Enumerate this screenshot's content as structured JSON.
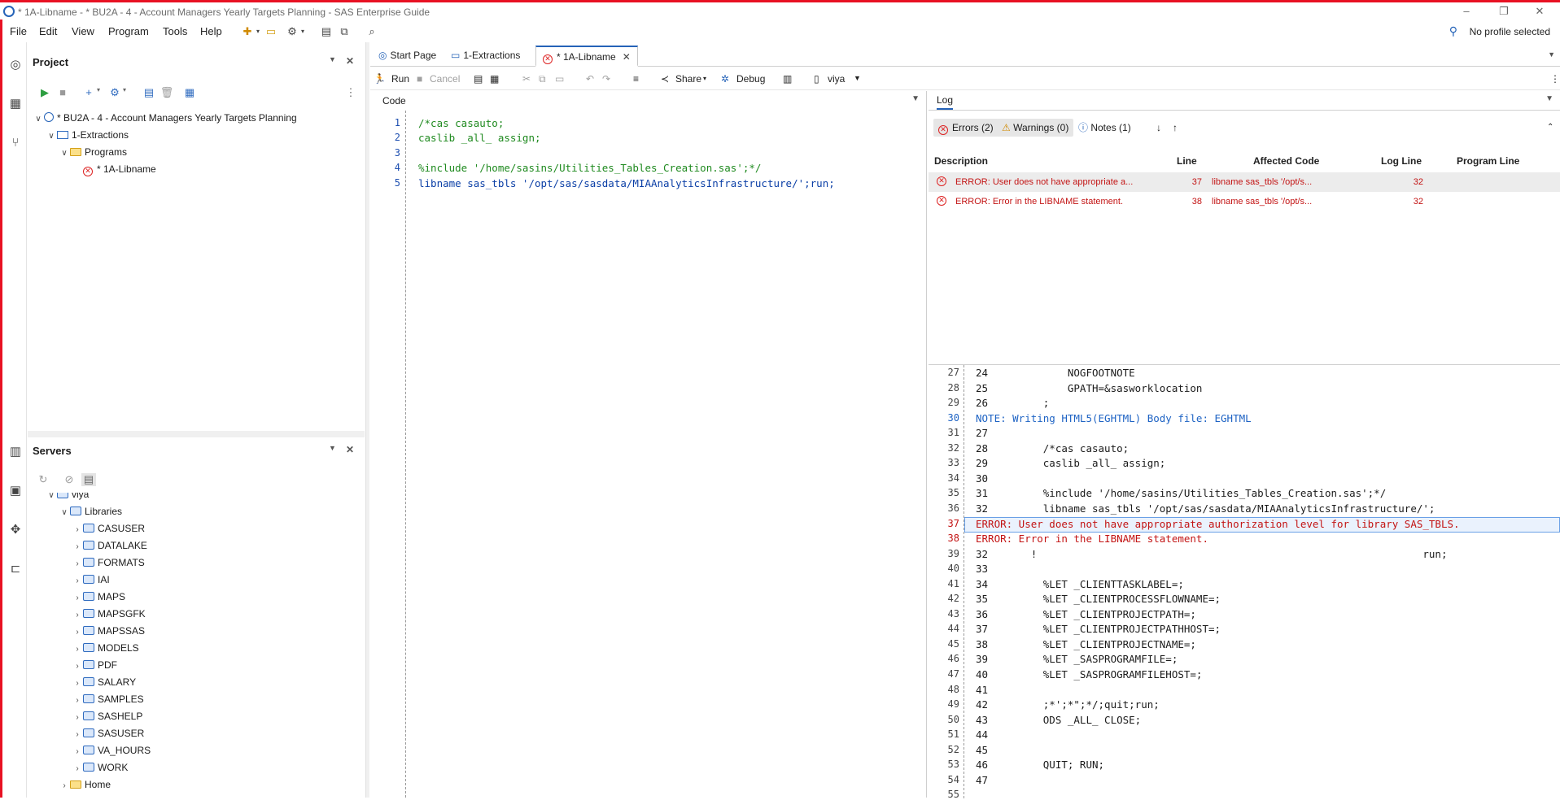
{
  "window": {
    "title": "* 1A-Libname - * BU2A - 4 - Account Managers Yearly Targets Planning - SAS Enterprise Guide"
  },
  "menu": {
    "items": [
      "File",
      "Edit",
      "View",
      "Program",
      "Tools",
      "Help"
    ],
    "profile_label": "No profile selected"
  },
  "project": {
    "title": "Project",
    "tree": [
      {
        "label": "* BU2A - 4 - Account Managers Yearly Targets Planning",
        "level": 0,
        "icon": "project-icon"
      },
      {
        "label": "1-Extractions",
        "level": 1,
        "icon": "process-flow-icon"
      },
      {
        "label": "Programs",
        "level": 2,
        "icon": "folder-icon"
      },
      {
        "label": "* 1A-Libname",
        "level": 3,
        "icon": "error-icon"
      }
    ]
  },
  "servers": {
    "title": "Servers",
    "partial_label": "viya",
    "libraries_label": "Libraries",
    "libraries": [
      "CASUSER",
      "DATALAKE",
      "FORMATS",
      "IAI",
      "MAPS",
      "MAPSGFK",
      "MAPSSAS",
      "MODELS",
      "PDF",
      "SALARY",
      "SAMPLES",
      "SASHELP",
      "SASUSER",
      "VA_HOURS",
      "WORK"
    ],
    "home_label": "Home"
  },
  "tabs": [
    {
      "label": "Start Page",
      "icon": "start-page-icon"
    },
    {
      "label": "1-Extractions",
      "icon": "process-flow-icon"
    },
    {
      "label": "* 1A-Libname",
      "icon": "error-icon",
      "active": true
    }
  ],
  "toolbar": {
    "run_label": "Run",
    "cancel_label": "Cancel",
    "share_label": "Share",
    "debug_label": "Debug",
    "server_label": "viya"
  },
  "code": {
    "header": "Code",
    "lines": [
      {
        "n": "1",
        "text": "/*cas casauto;"
      },
      {
        "n": "2",
        "text": "caslib _all_ assign;"
      },
      {
        "n": "3",
        "text": ""
      },
      {
        "n": "4",
        "text": "%include '/home/sasins/Utilities_Tables_Creation.sas';*/"
      },
      {
        "n": "5",
        "text": "libname sas_tbls '/opt/sas/sasdata/MIAAnalyticsInfrastructure/';run;"
      }
    ]
  },
  "log": {
    "header": "Log",
    "filters": {
      "errors": "Errors (2)",
      "warnings": "Warnings (0)",
      "notes": "Notes (1)"
    },
    "columns": [
      "Description",
      "Line",
      "Affected Code",
      "Log Line",
      "Program Line"
    ],
    "messages": [
      {
        "description": "ERROR: User does not have appropriate a...",
        "line": "37",
        "affected": "libname sas_tbls '/opt/s...",
        "log_line": "32",
        "program_line": ""
      },
      {
        "description": "ERROR: Error in the LIBNAME statement.",
        "line": "38",
        "affected": "libname sas_tbls '/opt/s...",
        "log_line": "32",
        "program_line": ""
      }
    ],
    "lines": [
      {
        "n": "27",
        "text": "24             NOGFOOTNOTE",
        "kind": "normal"
      },
      {
        "n": "28",
        "text": "25             GPATH=&sasworklocation",
        "kind": "normal"
      },
      {
        "n": "29",
        "text": "26         ;",
        "kind": "normal"
      },
      {
        "n": "30",
        "text": "NOTE: Writing HTML5(EGHTML) Body file: EGHTML",
        "kind": "note"
      },
      {
        "n": "31",
        "text": "27",
        "kind": "normal"
      },
      {
        "n": "32",
        "text": "28         /*cas casauto;",
        "kind": "normal"
      },
      {
        "n": "33",
        "text": "29         caslib _all_ assign;",
        "kind": "normal"
      },
      {
        "n": "34",
        "text": "30",
        "kind": "normal"
      },
      {
        "n": "35",
        "text": "31         %include '/home/sasins/Utilities_Tables_Creation.sas';*/",
        "kind": "normal"
      },
      {
        "n": "36",
        "text": "32         libname sas_tbls '/opt/sas/sasdata/MIAAnalyticsInfrastructure/';",
        "kind": "normal"
      },
      {
        "n": "37",
        "text": "ERROR: User does not have appropriate authorization level for library SAS_TBLS.",
        "kind": "err",
        "highlight": true
      },
      {
        "n": "38",
        "text": "ERROR: Error in the LIBNAME statement.",
        "kind": "err"
      },
      {
        "n": "39",
        "text": "32       !                                                               run;",
        "kind": "normal"
      },
      {
        "n": "40",
        "text": "33",
        "kind": "normal"
      },
      {
        "n": "41",
        "text": "34         %LET _CLIENTTASKLABEL=;",
        "kind": "normal"
      },
      {
        "n": "42",
        "text": "35         %LET _CLIENTPROCESSFLOWNAME=;",
        "kind": "normal"
      },
      {
        "n": "43",
        "text": "36         %LET _CLIENTPROJECTPATH=;",
        "kind": "normal"
      },
      {
        "n": "44",
        "text": "37         %LET _CLIENTPROJECTPATHHOST=;",
        "kind": "normal"
      },
      {
        "n": "45",
        "text": "38         %LET _CLIENTPROJECTNAME=;",
        "kind": "normal"
      },
      {
        "n": "46",
        "text": "39         %LET _SASPROGRAMFILE=;",
        "kind": "normal"
      },
      {
        "n": "47",
        "text": "40         %LET _SASPROGRAMFILEHOST=;",
        "kind": "normal"
      },
      {
        "n": "48",
        "text": "41",
        "kind": "normal"
      },
      {
        "n": "49",
        "text": "42         ;*';*\";*/;quit;run;",
        "kind": "normal"
      },
      {
        "n": "50",
        "text": "43         ODS _ALL_ CLOSE;",
        "kind": "normal"
      },
      {
        "n": "51",
        "text": "44",
        "kind": "normal"
      },
      {
        "n": "52",
        "text": "45",
        "kind": "normal"
      },
      {
        "n": "53",
        "text": "46         QUIT; RUN;",
        "kind": "normal"
      },
      {
        "n": "54",
        "text": "47",
        "kind": "normal"
      },
      {
        "n": "55",
        "text": "",
        "kind": "normal"
      }
    ]
  },
  "colors": {
    "accent": "#2563b8",
    "error": "#c31414",
    "note": "#1e63c4",
    "comment": "#1f8a1f"
  }
}
